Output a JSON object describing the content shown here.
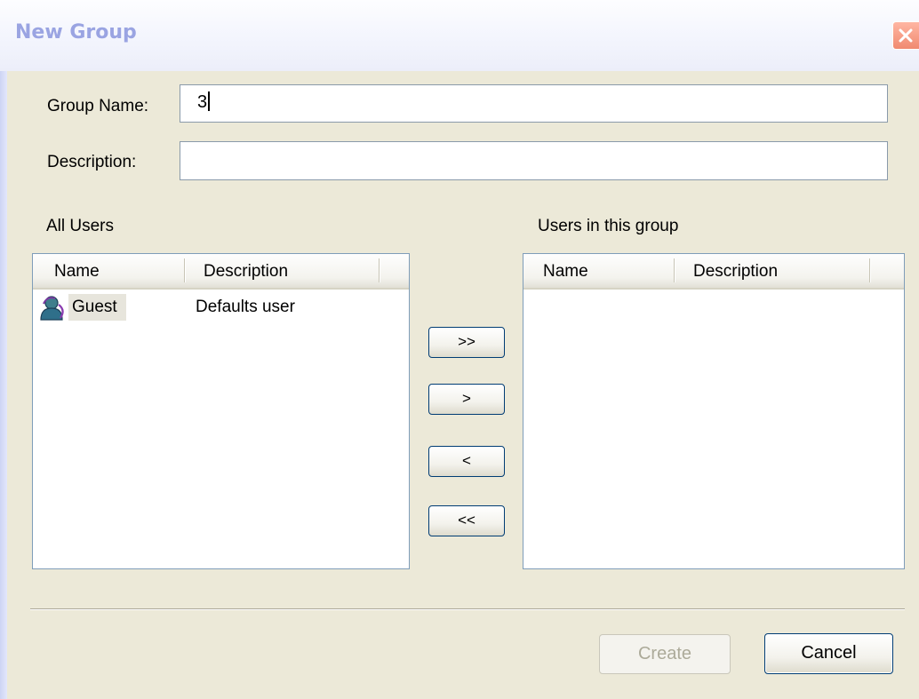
{
  "dialog": {
    "title": "New Group",
    "close_label": "×"
  },
  "form": {
    "group_name_label": "Group Name:",
    "group_name_value": "3",
    "description_label": "Description:",
    "description_value": ""
  },
  "all_users": {
    "title": "All Users",
    "columns": [
      "Name",
      "Description"
    ],
    "rows": [
      {
        "name": "Guest",
        "description": "Defaults user",
        "icon": "user-icon"
      }
    ]
  },
  "group_users": {
    "title": "Users in this group",
    "columns": [
      "Name",
      "Description"
    ],
    "rows": []
  },
  "move_buttons": {
    "add_all": ">>",
    "add": ">",
    "remove": "<",
    "remove_all": "<<"
  },
  "actions": {
    "create": "Create",
    "cancel": "Cancel",
    "create_enabled": false
  },
  "colors": {
    "title_text": "#9aa4e2",
    "close_button": "#f08a70",
    "dialog_bg": "#ece9d8"
  }
}
